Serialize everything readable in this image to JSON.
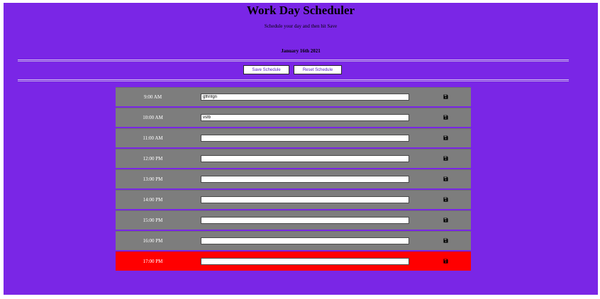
{
  "header": {
    "title": "Work Day Scheduler",
    "subtitle": "Schedule your day and then hit Save",
    "date": "January 16th 2021"
  },
  "controls": {
    "save_label": "Save Schedule",
    "reset_label": "Reset Schedule"
  },
  "colors": {
    "background": "#7a26e6",
    "past_row": "#7d7d7d",
    "current_row": "#ff0000"
  },
  "save_icon": "floppy-disk-icon",
  "rows": [
    {
      "hour": "9:00 AM",
      "task": "gfhnfgn",
      "state": "past"
    },
    {
      "hour": "10:00 AM",
      "task": "vsfb",
      "state": "past"
    },
    {
      "hour": "11:00 AM",
      "task": "",
      "state": "past"
    },
    {
      "hour": "12:00 PM",
      "task": "",
      "state": "past"
    },
    {
      "hour": "13:00 PM",
      "task": "",
      "state": "past"
    },
    {
      "hour": "14:00 PM",
      "task": "",
      "state": "past"
    },
    {
      "hour": "15:00 PM",
      "task": "",
      "state": "past"
    },
    {
      "hour": "16:00 PM",
      "task": "",
      "state": "past"
    },
    {
      "hour": "17:00 PM",
      "task": "",
      "state": "current"
    }
  ]
}
